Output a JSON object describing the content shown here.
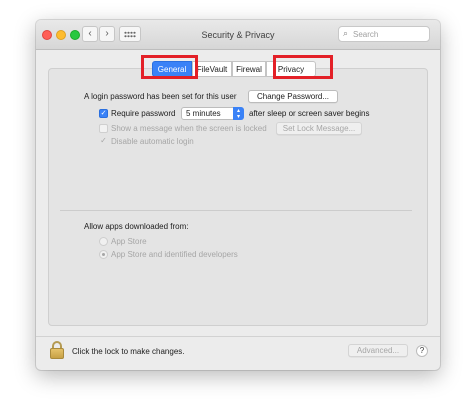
{
  "window": {
    "title": "Security & Privacy",
    "search_placeholder": "Search",
    "nav_back": "‹",
    "nav_forward": "›"
  },
  "tabs": [
    {
      "label": "General",
      "selected": true
    },
    {
      "label": "FileVault",
      "selected": false
    },
    {
      "label": "Firewal",
      "selected": false
    },
    {
      "label": "Privacy",
      "selected": false
    }
  ],
  "general": {
    "login_password_text": "A login password has been set for this user",
    "change_password_button": "Change Password...",
    "require_password": {
      "label": "Require password",
      "checked": true
    },
    "require_password_delay": "5 minutes",
    "after_sleep_text": "after sleep or screen saver begins",
    "show_message": {
      "label": "Show a message when the screen is locked",
      "checked": false,
      "enabled": false
    },
    "set_lock_message_button": "Set Lock Message...",
    "disable_auto_login": {
      "label": "Disable automatic login",
      "checked": true,
      "enabled": false
    }
  },
  "allow_apps": {
    "heading": "Allow apps downloaded from:",
    "options": [
      {
        "label": "App Store",
        "selected": false
      },
      {
        "label": "App Store and identified developers",
        "selected": true
      }
    ]
  },
  "footer": {
    "lock_text": "Click the lock to make changes.",
    "advanced_button": "Advanced...",
    "help_button": "?"
  },
  "colors": {
    "accent": "#3a82f7",
    "highlight": "#e32027"
  },
  "icons": {
    "search": "search-icon",
    "lock": "lock-icon",
    "grid": "grid-icon"
  }
}
